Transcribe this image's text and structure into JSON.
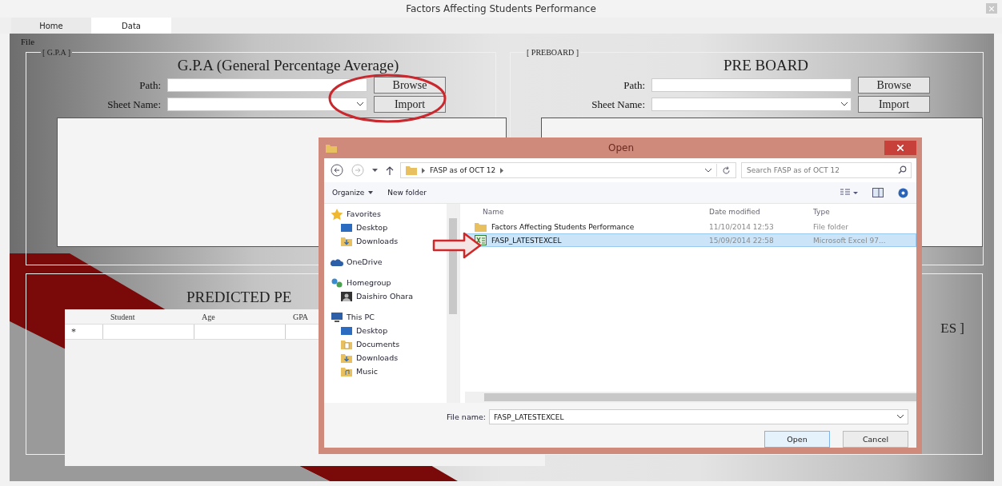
{
  "window": {
    "title": "Factors Affecting Students Performance"
  },
  "tabs": [
    {
      "label": "Home",
      "selected": false
    },
    {
      "label": "Data",
      "selected": true
    }
  ],
  "menu": [
    "File"
  ],
  "gpa_group": {
    "legend": "[ G.P.A ]",
    "title": "G.P.A (General Percentage Average)",
    "path_label": "Path:",
    "sheet_label": "Sheet Name:",
    "browse": "Browse",
    "import": "Import"
  },
  "preboard_group": {
    "legend": "[ PREBOARD ]",
    "title": "PRE BOARD",
    "path_label": "Path:",
    "sheet_label": "Sheet Name:",
    "browse": "Browse",
    "import": "Import"
  },
  "predicted_group": {
    "title": "PREDICTED PE",
    "side_text": "ES ]",
    "columns": [
      "Student",
      "Age",
      "GPA"
    ],
    "new_row_marker": "*"
  },
  "dialog": {
    "title": "Open",
    "breadcrumb": "FASP as of OCT 12",
    "search": {
      "placeholder": "Search FASP as of OCT 12"
    },
    "toolbar": {
      "organize": "Organize",
      "new_folder": "New folder"
    },
    "nav": [
      {
        "label": "Favorites",
        "kind": "star",
        "children": [
          {
            "label": "Desktop",
            "kind": "desktop"
          },
          {
            "label": "Downloads",
            "kind": "downloads"
          }
        ]
      },
      {
        "label": "OneDrive",
        "kind": "cloud"
      },
      {
        "label": "Homegroup",
        "kind": "network",
        "children": [
          {
            "label": "Daishiro Ohara",
            "kind": "user"
          }
        ]
      },
      {
        "label": "This PC",
        "kind": "computer",
        "children": [
          {
            "label": "Desktop",
            "kind": "desktop"
          },
          {
            "label": "Documents",
            "kind": "documents"
          },
          {
            "label": "Downloads",
            "kind": "downloads"
          },
          {
            "label": "Music",
            "kind": "music"
          }
        ]
      }
    ],
    "columns": [
      "Name",
      "Date modified",
      "Type"
    ],
    "files": [
      {
        "kind": "folder",
        "name": "Factors Affecting Students Performance",
        "date": "11/10/2014 12:53",
        "type": "File folder",
        "selected": false
      },
      {
        "kind": "excel",
        "name": "FASP_LATESTEXCEL",
        "date": "15/09/2014 22:58",
        "type": "Microsoft Excel 97...",
        "selected": true
      }
    ],
    "file_name_label": "File name:",
    "file_name": "FASP_LATESTEXCEL",
    "open": "Open",
    "cancel": "Cancel"
  }
}
